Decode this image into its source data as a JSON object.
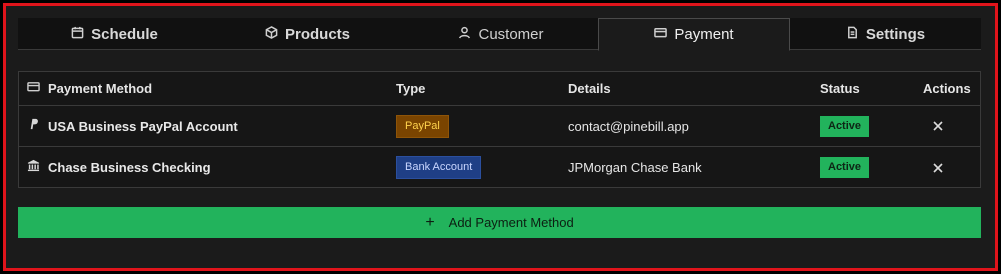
{
  "tabs": [
    {
      "label": "Schedule",
      "icon": "calendar-icon",
      "active": false
    },
    {
      "label": "Products",
      "icon": "box-icon",
      "active": false
    },
    {
      "label": "Customer",
      "icon": "user-icon",
      "active": false
    },
    {
      "label": "Payment",
      "icon": "card-icon",
      "active": true
    },
    {
      "label": "Settings",
      "icon": "document-icon",
      "active": false
    }
  ],
  "table": {
    "headers": {
      "method": "Payment Method",
      "type": "Type",
      "details": "Details",
      "status": "Status",
      "actions": "Actions"
    },
    "rows": [
      {
        "name": "USA Business PayPal Account",
        "icon": "paypal-icon",
        "type": "PayPal",
        "details": "contact@pinebill.app",
        "status": "Active"
      },
      {
        "name": "Chase Business Checking",
        "icon": "bank-icon",
        "type": "Bank Account",
        "details": "JPMorgan Chase Bank",
        "status": "Active"
      }
    ]
  },
  "add_button": {
    "label": "Add Payment Method",
    "icon": "plus-icon"
  },
  "colors": {
    "accent_red": "#e0141b",
    "success": "#22b35c",
    "paypal_bg": "#7a4400",
    "bank_bg": "#1f3f86"
  }
}
